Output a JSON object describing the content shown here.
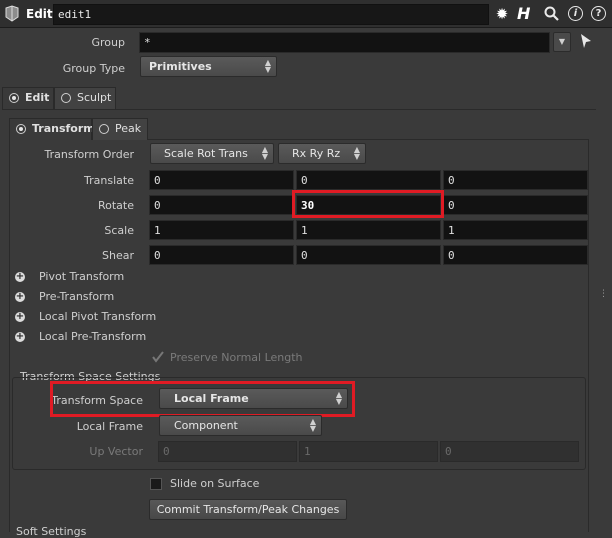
{
  "header": {
    "title": "Edit",
    "node_name": "edit1",
    "icons": [
      "gear-icon",
      "houdini-help-icon",
      "search-icon",
      "info-icon",
      "help-icon"
    ],
    "help_glyph": "H",
    "info_glyph": "i",
    "question_glyph": "?"
  },
  "top": {
    "group_label": "Group",
    "group_value": "*",
    "group_type_label": "Group Type",
    "group_type_value": "Primitives"
  },
  "mode_tabs": [
    {
      "label": "Edit",
      "selected": true
    },
    {
      "label": "Sculpt",
      "selected": false
    }
  ],
  "sub_tabs": [
    {
      "label": "Transform",
      "selected": true
    },
    {
      "label": "Peak",
      "selected": false
    }
  ],
  "transform": {
    "order_label": "Transform Order",
    "order_value": "Scale Rot Trans",
    "rot_order_value": "Rx Ry Rz",
    "rows": [
      {
        "label": "Translate",
        "values": [
          "0",
          "0",
          "0"
        ]
      },
      {
        "label": "Rotate",
        "values": [
          "0",
          "30",
          "0"
        ]
      },
      {
        "label": "Scale",
        "values": [
          "1",
          "1",
          "1"
        ]
      },
      {
        "label": "Shear",
        "values": [
          "0",
          "0",
          "0"
        ]
      }
    ],
    "folders": [
      "Pivot Transform",
      "Pre-Transform",
      "Local Pivot Transform",
      "Local Pre-Transform"
    ],
    "preserve_normal_label": "Preserve Normal Length"
  },
  "space_settings": {
    "section_label": "Transform Space Settings",
    "space_label": "Transform Space",
    "space_value": "Local Frame",
    "local_frame_label": "Local Frame",
    "local_frame_value": "Component",
    "up_vector_label": "Up Vector",
    "up_vector_values": [
      "0",
      "1",
      "0"
    ]
  },
  "slide_label": "Slide on Surface",
  "commit_button": "Commit Transform/Peak Changes",
  "soft_settings_label": "Soft Settings",
  "colors": {
    "highlight": "#e01b24",
    "field_bg": "#121212",
    "panel_bg": "#3a3a3a"
  }
}
